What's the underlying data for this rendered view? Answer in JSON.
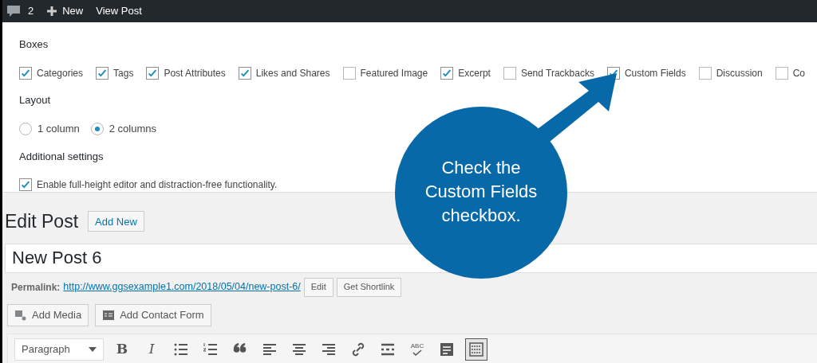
{
  "admin_bar": {
    "comments": "2",
    "new": "New",
    "view": "View Post"
  },
  "screen_options": {
    "boxes_label": "Boxes",
    "boxes": [
      {
        "label": "Categories",
        "checked": true
      },
      {
        "label": "Tags",
        "checked": true
      },
      {
        "label": "Post Attributes",
        "checked": true
      },
      {
        "label": "Likes and Shares",
        "checked": true
      },
      {
        "label": "Featured Image",
        "checked": false
      },
      {
        "label": "Excerpt",
        "checked": true
      },
      {
        "label": "Send Trackbacks",
        "checked": false
      },
      {
        "label": "Custom Fields",
        "checked": true
      },
      {
        "label": "Discussion",
        "checked": false
      },
      {
        "label": "Co",
        "checked": false
      }
    ],
    "layout_label": "Layout",
    "layout": [
      {
        "label": "1 column",
        "selected": false
      },
      {
        "label": "2 columns",
        "selected": true
      }
    ],
    "additional_label": "Additional settings",
    "additional": [
      {
        "label": "Enable full-height editor and distraction-free functionality.",
        "checked": true
      }
    ]
  },
  "heading": "Edit Post",
  "add_new": "Add New",
  "title_value": "New Post 6",
  "permalink": {
    "label": "Permalink:",
    "url": "http://www.ggsexample1.com/2018/05/04/new-post-6/",
    "edit": "Edit",
    "shortlink": "Get Shortlink"
  },
  "media_buttons": [
    "Add Media",
    "Add Contact Form"
  ],
  "editor_toolbar": {
    "format": "Paragraph",
    "tools": [
      {
        "kind": "bold",
        "label": "B",
        "selected": false
      },
      {
        "kind": "italic",
        "label": "I",
        "selected": false
      },
      {
        "kind": "bullets",
        "selected": false
      },
      {
        "kind": "numbers",
        "selected": false
      },
      {
        "kind": "quote",
        "selected": false
      },
      {
        "kind": "align-left",
        "selected": false
      },
      {
        "kind": "align-center",
        "selected": false
      },
      {
        "kind": "align-right",
        "selected": false
      },
      {
        "kind": "link",
        "selected": false
      },
      {
        "kind": "more",
        "selected": false
      },
      {
        "kind": "spell",
        "label": "ABC",
        "selected": false
      },
      {
        "kind": "form",
        "selected": false
      },
      {
        "kind": "kitchen",
        "selected": true
      }
    ]
  },
  "callout": {
    "text": "Check the Custom Fields checkbox."
  }
}
